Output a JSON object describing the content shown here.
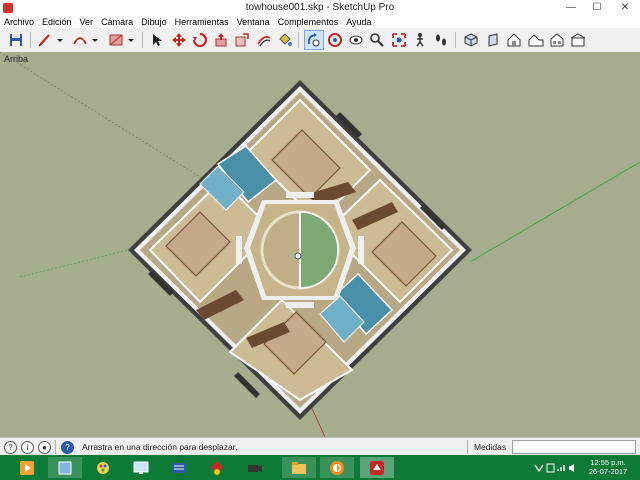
{
  "window": {
    "title": "towhouse001.skp - SketchUp Pro",
    "minimize": "—",
    "maximize": "☐",
    "close": "✕"
  },
  "menu": [
    "Archivo",
    "Edición",
    "Ver",
    "Cámara",
    "Dibujo",
    "Herramientas",
    "Ventana",
    "Complementos",
    "Ayuda"
  ],
  "toolbar": {
    "tools": [
      "save-icon",
      "pencil-icon",
      "arc-icon",
      "rectangle-icon",
      "select-icon",
      "move-icon",
      "rotate-icon",
      "pushpull-icon",
      "paint-bucket-icon",
      "offset-icon",
      "measure-icon",
      "orbit-icon",
      "pan-icon",
      "look-around-icon",
      "zoom-icon",
      "zoom-extents-icon",
      "walk-icon",
      "footprint-icon",
      "iso-view-icon",
      "front-view-icon",
      "house-icon",
      "house-right-icon",
      "house-back-icon",
      "house-left-icon"
    ],
    "active_tool": "orbit-icon"
  },
  "viewport": {
    "label": "Arriba",
    "background": "#a6ad8f"
  },
  "status": {
    "message": "Arrastra en una dirección para desplazar.",
    "measurements_label": "Medidas",
    "measurements_value": ""
  },
  "taskbar": {
    "apps": [
      "media-player-icon",
      "documents-icon",
      "paint-icon",
      "display-settings-icon",
      "network-icon",
      "ruby-icon",
      "recorder-icon",
      "file-explorer-icon",
      "firefox-icon",
      "sketchup-icon"
    ],
    "active_app": "sketchup-icon",
    "clock_time": "12:55 p.m.",
    "clock_date": "26-07-2017"
  }
}
